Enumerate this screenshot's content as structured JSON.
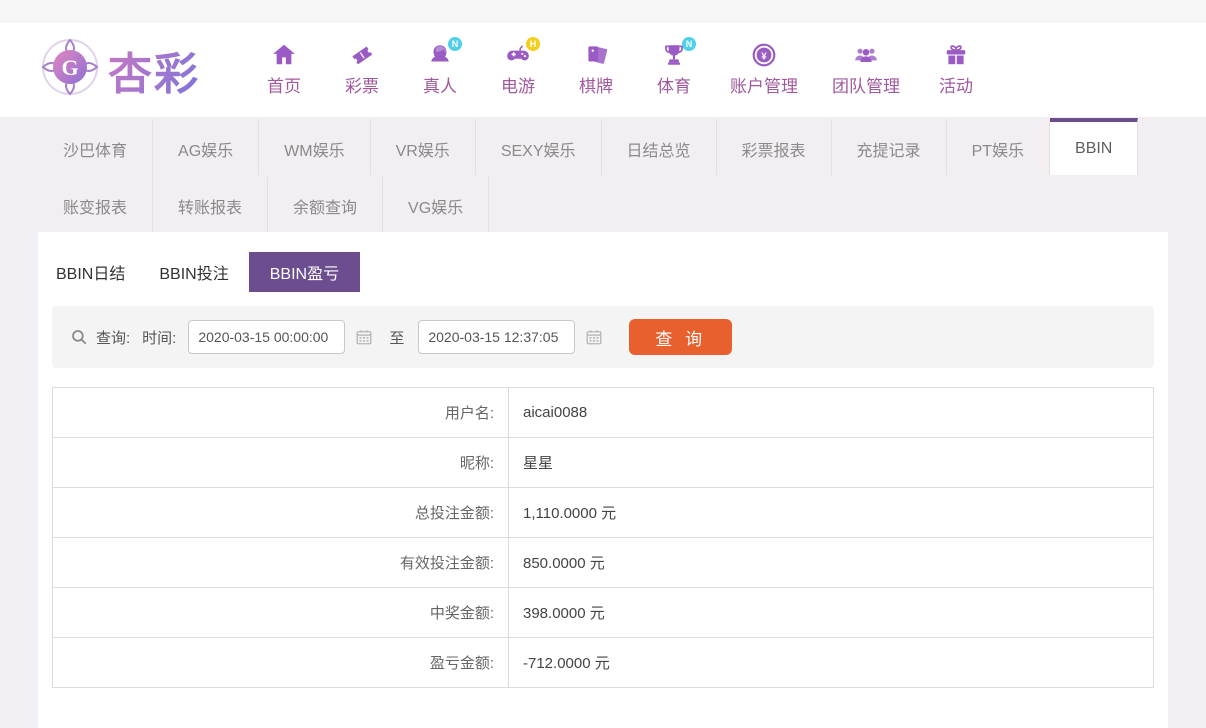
{
  "brand": {
    "name": "杏彩",
    "mark_letter": "G"
  },
  "nav": {
    "items": [
      {
        "label": "首页",
        "icon": "home-icon"
      },
      {
        "label": "彩票",
        "icon": "ticket-icon"
      },
      {
        "label": "真人",
        "icon": "live-dealer-icon",
        "badge": "N"
      },
      {
        "label": "电游",
        "icon": "gamepad-icon",
        "badge": "H"
      },
      {
        "label": "棋牌",
        "icon": "cards-icon"
      },
      {
        "label": "体育",
        "icon": "trophy-icon",
        "badge": "N"
      },
      {
        "label": "账户管理",
        "icon": "coin-icon"
      },
      {
        "label": "团队管理",
        "icon": "team-icon"
      },
      {
        "label": "活动",
        "icon": "gift-icon"
      }
    ]
  },
  "tabs": {
    "row1": [
      "沙巴体育",
      "AG娱乐",
      "WM娱乐",
      "VR娱乐",
      "SEXY娱乐",
      "日结总览",
      "彩票报表",
      "充提记录",
      "PT娱乐",
      "BBIN",
      "账变报表",
      "转账报表"
    ],
    "row2": [
      "余额查询",
      "VG娱乐"
    ],
    "active": "BBIN"
  },
  "subtabs": {
    "items": [
      "BBIN日结",
      "BBIN投注",
      "BBIN盈亏"
    ],
    "active": "BBIN盈亏"
  },
  "query": {
    "search_label": "查询:",
    "time_label": "时间:",
    "from_value": "2020-03-15 00:00:00",
    "to_label": "至",
    "to_value": "2020-03-15 12:37:05",
    "button_label": "查 询"
  },
  "table": {
    "rows": [
      {
        "label": "用户名:",
        "value": "aicai0088"
      },
      {
        "label": "昵称:",
        "value": "星星"
      },
      {
        "label": "总投注金额:",
        "value": "1,110.0000 元"
      },
      {
        "label": "有效投注金额:",
        "value": "850.0000 元"
      },
      {
        "label": "中奖金额:",
        "value": "398.0000 元"
      },
      {
        "label": "盈亏金额:",
        "value": "-712.0000 元"
      }
    ]
  },
  "colors": {
    "accent_purple": "#6b4d90",
    "nav_purple": "#9a5bc4",
    "nav_label": "#a0589e",
    "button_orange": "#e7602e",
    "badge_cyan": "#4fd0e8",
    "badge_yellow": "#f2cf1d",
    "tabbar_bg": "#f2eef2",
    "page_bg": "#f3f0f5"
  }
}
